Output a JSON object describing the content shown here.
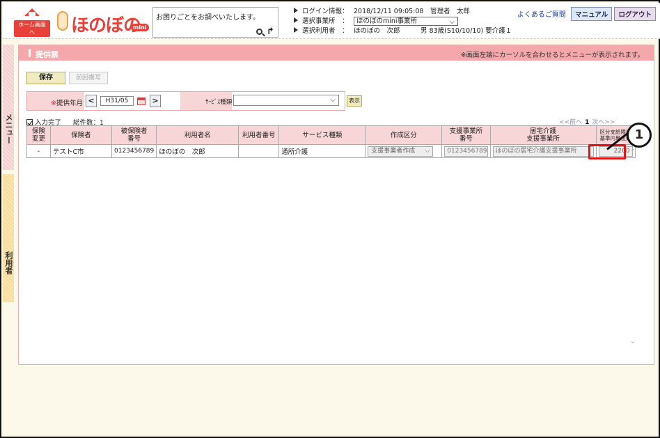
{
  "header": {
    "home_label": "ホーム画面へ",
    "logo_text": "ほのぼの",
    "logo_suffix": "mini",
    "search_placeholder": "お困りごとをお調べいたします。",
    "login_label": "ログイン情報：",
    "login_value": "2018/12/11 09:05:08　管理者　太郎",
    "office_label": "選択事業所　：",
    "office_value": "ほのぼのmini事業所",
    "user_label": "選択利用者　：",
    "user_value": "ほのぼの　次郎",
    "user_detail": "男 83歳(S10/10/10) 要介護１",
    "faq_link": "よくあるご質問",
    "manual_button": "マニュアル",
    "logout_button": "ログアウト"
  },
  "side": {
    "menu_tab": "メニュー",
    "user_tab": "利用者"
  },
  "page": {
    "title": "提供票",
    "note": "※画面左端にカーソルを合わせるとメニューが表示されます。",
    "save_button": "保存",
    "prev_copy_button": "前回複写",
    "month_label_req": "※",
    "month_label": "提供年月",
    "month_value": "H31/05",
    "service_label": "ｻｰﾋﾞｽ種類",
    "service_value": "",
    "show_button": "表示",
    "input_done_label": "入力完了",
    "total_count": "総件数：1",
    "pager_prev": "<<前へ",
    "pager_page": "1",
    "pager_next": "次へ>>"
  },
  "table": {
    "headers": [
      "保険\n変更",
      "保険者",
      "被保険者\n番号",
      "利用者名",
      "利用者番号",
      "サービス種類",
      "作成区分",
      "支援事業所\n番号",
      "居宅介護\n支援事業所",
      "区分支給限度\n基準内単位数"
    ],
    "rows": [
      {
        "change": "-",
        "insurer": "テストC市",
        "insured_no": "0123456789",
        "user_name": "ほのぼの　次郎",
        "user_no": "",
        "service": "通所介護",
        "category": "支援事業者作成",
        "support_no": "0123456789",
        "support_office": "ほのぼの居宅介護支援事業所",
        "units": "2200"
      }
    ]
  },
  "annotation": {
    "callout_number": "1"
  }
}
